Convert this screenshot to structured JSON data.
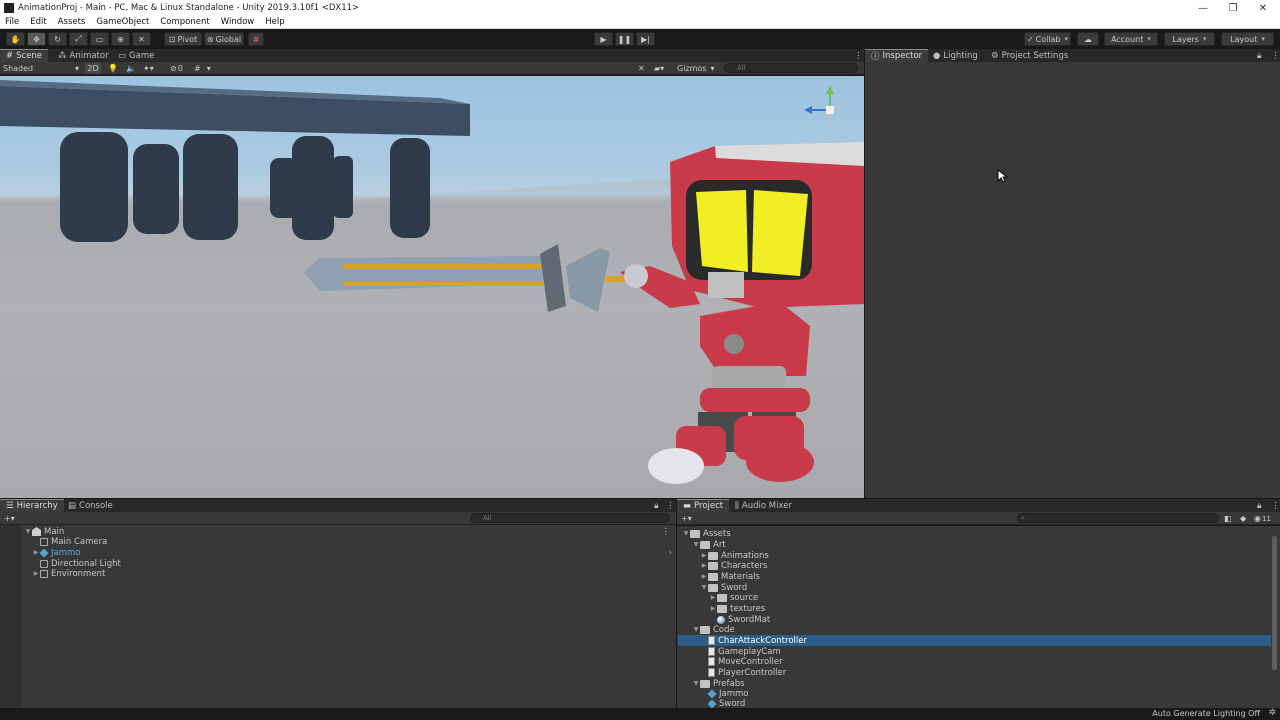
{
  "window": {
    "title": "AnimationProj - Main - PC, Mac & Linux Standalone - Unity 2019.3.10f1 <DX11>",
    "minimize_glyph": "—",
    "restore_glyph": "❐",
    "close_glyph": "✕"
  },
  "menu": [
    "File",
    "Edit",
    "Assets",
    "GameObject",
    "Component",
    "Window",
    "Help"
  ],
  "toolbar": {
    "pivot_label": "Pivot",
    "global_label": "Global",
    "collab_label": "Collab",
    "account_label": "Account",
    "layers_label": "Layers",
    "layout_label": "Layout"
  },
  "scene_tabs": [
    "Scene",
    "Animator",
    "Game"
  ],
  "scene_toolbar": {
    "draw_mode": "Shaded",
    "mode_2d": "2D",
    "hidden_count": "0",
    "gizmos_label": "Gizmos",
    "search_placeholder": "All"
  },
  "right_tabs": [
    "Inspector",
    "Lighting",
    "Project Settings"
  ],
  "hierarchy": {
    "tabs": [
      "Hierarchy",
      "Console"
    ],
    "search_placeholder": "All",
    "scene": "Main",
    "items": [
      "Main Camera",
      "Jammo",
      "Directional Light",
      "Environment"
    ]
  },
  "project": {
    "tabs": [
      "Project",
      "Audio Mixer"
    ],
    "badge": "11",
    "tree": {
      "assets": "Assets",
      "art": "Art",
      "art_children": [
        "Animations",
        "Characters",
        "Materials"
      ],
      "sword": "Sword",
      "sword_children": [
        "source",
        "textures"
      ],
      "sword_mat": "SwordMat",
      "code": "Code",
      "code_children": [
        "CharAttackController",
        "GameplayCam",
        "MoveController",
        "PlayerController"
      ],
      "prefabs": "Prefabs",
      "prefab_children": [
        "Jammo",
        "Sword"
      ]
    }
  },
  "status": {
    "text": "Auto Generate Lighting Off"
  },
  "colors": {
    "selection": "#2c5d87",
    "prefab_blue": "#54a0d0",
    "robot_red": "#c93a4b",
    "visor_yellow": "#f2ee24",
    "sword_gold": "#d8a227"
  }
}
